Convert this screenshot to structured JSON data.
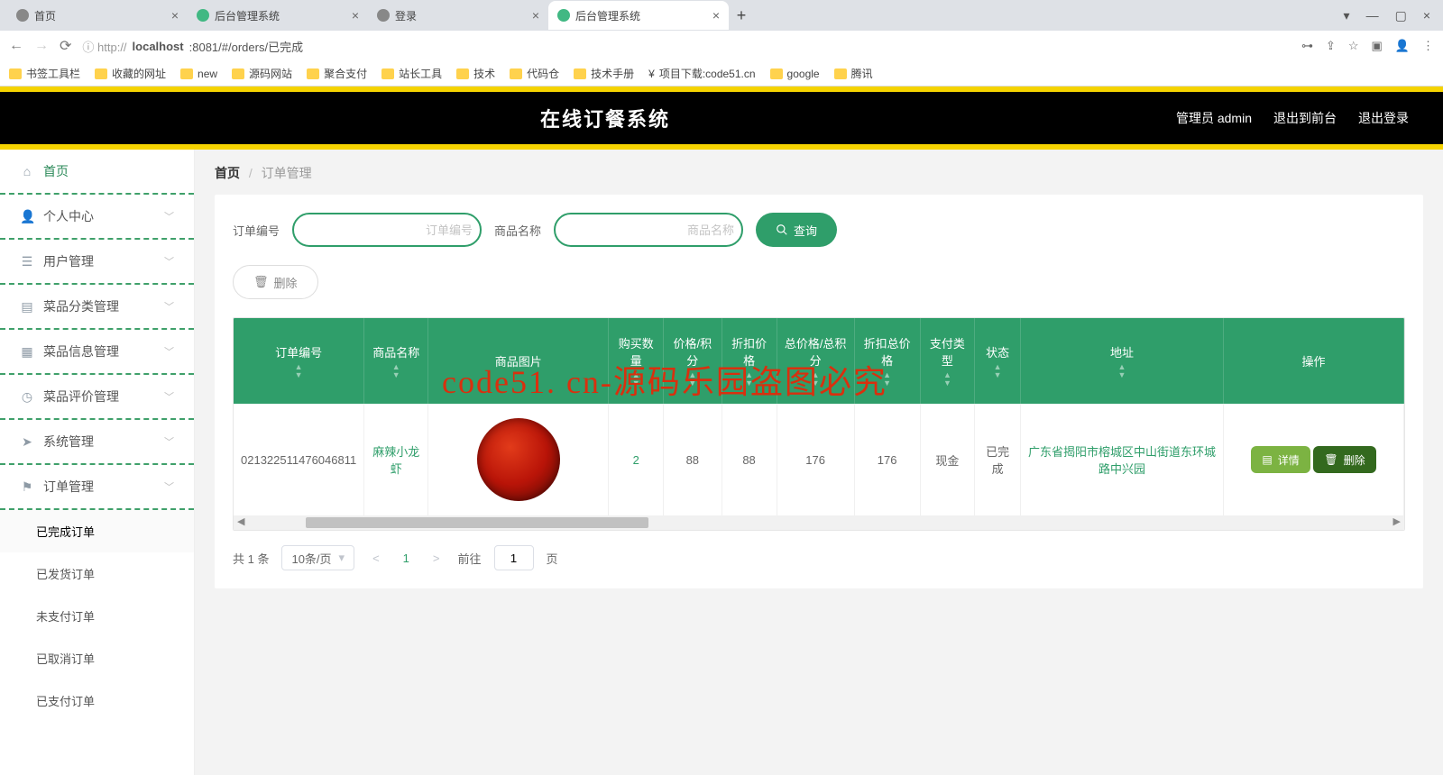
{
  "browser": {
    "tabs": [
      {
        "title": "首页",
        "favicon": "gray"
      },
      {
        "title": "后台管理系统",
        "favicon": "green"
      },
      {
        "title": "登录",
        "favicon": "gray"
      },
      {
        "title": "后台管理系统",
        "favicon": "green",
        "active": true
      }
    ],
    "url_proto": "ⓘ http://",
    "url_host": "localhost",
    "url_rest": ":8081/#/orders/已完成",
    "bookmarks": [
      "书签工具栏",
      "收藏的网址",
      "new",
      "源码网站",
      "聚合支付",
      "站长工具",
      "技术",
      "代码仓",
      "技术手册",
      "项目下载:code51.cn",
      "google",
      "腾讯"
    ]
  },
  "header": {
    "title": "在线订餐系统",
    "user": "管理员 admin",
    "front": "退出到前台",
    "logout": "退出登录"
  },
  "sidebar": {
    "items": [
      {
        "icon": "🏠",
        "label": "首页",
        "active": true
      },
      {
        "icon": "👤",
        "label": "个人中心",
        "caret": true
      },
      {
        "icon": "⇄",
        "label": "用户管理",
        "caret": true
      },
      {
        "icon": "🗂",
        "label": "菜品分类管理",
        "caret": true
      },
      {
        "icon": "📋",
        "label": "菜品信息管理",
        "caret": true
      },
      {
        "icon": "⊙",
        "label": "菜品评价管理",
        "caret": true
      },
      {
        "icon": "✈",
        "label": "系统管理",
        "caret": true
      },
      {
        "icon": "⚑",
        "label": "订单管理",
        "caret": true,
        "open": true
      }
    ],
    "order_sub": [
      "已完成订单",
      "已发货订单",
      "未支付订单",
      "已取消订单",
      "已支付订单"
    ]
  },
  "breadcrumb": {
    "home": "首页",
    "cur": "订单管理"
  },
  "filters": {
    "order_no_label": "订单编号",
    "order_no_ph": "订单编号",
    "product_label": "商品名称",
    "product_ph": "商品名称",
    "search": "查询",
    "delete": "删除"
  },
  "table": {
    "cols": [
      "订单编号",
      "商品名称",
      "商品图片",
      "购买数量",
      "价格/积分",
      "折扣价格",
      "总价格/总积分",
      "折扣总价格",
      "支付类型",
      "状态",
      "地址",
      "操作"
    ],
    "row": {
      "order_no": "021322511476046811",
      "product": "麻辣小龙虾",
      "qty": "2",
      "price": "88",
      "discount_price": "88",
      "total": "176",
      "discount_total": "176",
      "pay_type": "现金",
      "status": "已完成",
      "address": "广东省揭阳市榕城区中山街道东环城路中兴园"
    },
    "detail": "详情",
    "del": "删除"
  },
  "pagination": {
    "total": "共 1 条",
    "per_page": "10条/页",
    "page": "1",
    "goto": "前往",
    "page_unit": "页",
    "page_value": "1"
  },
  "watermark": "code51. cn-源码乐园盗图必究"
}
